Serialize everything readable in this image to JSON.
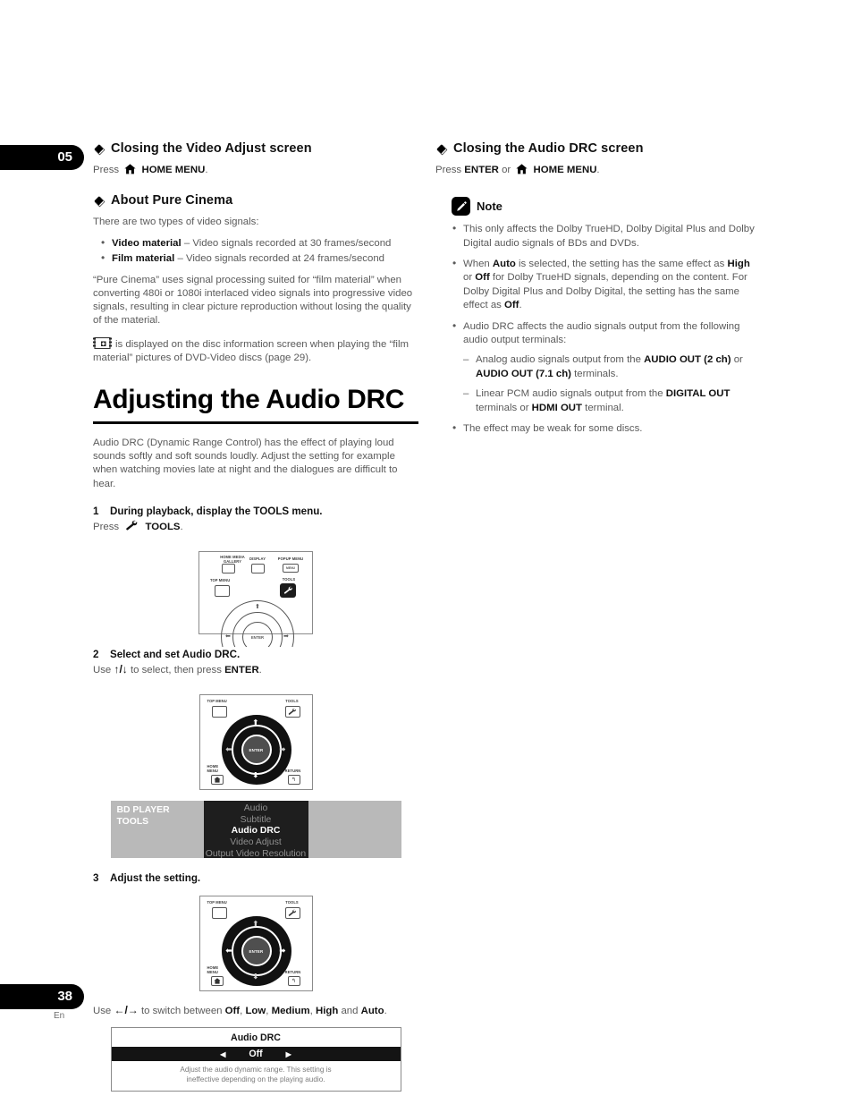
{
  "chapter_tab": "05",
  "page_tab": "38",
  "page_lang": "En",
  "left": {
    "section1": {
      "heading": "Closing the Video Adjust screen",
      "press_prefix": "Press",
      "home_menu_label": "HOME MENU",
      "period": "."
    },
    "section2": {
      "heading": "About Pure Cinema",
      "intro": "There are two types of video signals:",
      "bullets": [
        {
          "term": "Video material",
          "rest": " – Video signals recorded at 30 frames/second"
        },
        {
          "term": "Film material",
          "rest": " – Video signals recorded at 24 frames/second"
        }
      ],
      "paragraph": "“Pure Cinema” uses signal processing suited for “film material” when converting 480i or 1080i interlaced video signals into progressive video signals, resulting in clear picture reproduction without losing the quality of the material.",
      "film_note": "is displayed on the disc information screen when playing the “film material” pictures of DVD-Video discs (page 29)."
    },
    "title": "Adjusting the Audio DRC",
    "intro_paragraph": "Audio DRC (Dynamic Range Control) has the effect of playing loud sounds softly and soft sounds loudly. Adjust the setting for example when watching movies late at night and the dialogues are difficult to hear.",
    "step1": {
      "num": "1",
      "text": "During playback, display the TOOLS menu.",
      "press_prefix": "Press",
      "tools_label": "TOOLS",
      "period": "."
    },
    "step2": {
      "num": "2",
      "text": "Select and set Audio DRC.",
      "use_prefix": "Use",
      "arrows": "↑/↓",
      "use_mid": " to select, then press ",
      "enter_label": "ENTER",
      "period": "."
    },
    "step3": {
      "num": "3",
      "text": "Adjust the setting.",
      "use_prefix": "Use",
      "arrows": "←/→",
      "use_mid": " to switch between ",
      "options": [
        "Off",
        "Low",
        "Medium",
        "High",
        "Auto"
      ],
      "and_word": " and ",
      "period": "."
    },
    "osd_tools": {
      "title_line1": "BD PLAYER",
      "title_line2": "TOOLS",
      "items": [
        {
          "label": "Audio",
          "selected": false
        },
        {
          "label": "Subtitle",
          "selected": false
        },
        {
          "label": "Audio DRC",
          "selected": true
        },
        {
          "label": "Video Adjust",
          "selected": false
        },
        {
          "label": "Output Video Resolution",
          "selected": false
        }
      ]
    },
    "osd_drc": {
      "title": "Audio DRC",
      "left_arrow": "◀",
      "value": "Off",
      "right_arrow": "▶",
      "desc_line1": "Adjust the audio dynamic range. This setting is",
      "desc_line2": "ineffective depending on the playing audio."
    },
    "remote1": {
      "labels": {
        "home_media_gallery_l1": "HOME MEDIA",
        "home_media_gallery_l2": "GALLERY",
        "display": "DISPLAY",
        "popup_menu": "POPUP MENU",
        "popup_menu_word": "MENU",
        "top_menu": "TOP MENU",
        "tools": "TOOLS",
        "enter": "ENTER"
      }
    },
    "remote2": {
      "labels": {
        "top_menu": "TOP MENU",
        "tools": "TOOLS",
        "home_menu_l1": "HOME",
        "home_menu_l2": "MENU",
        "return": "RETURN",
        "enter": "ENTER"
      },
      "highlight": "vertical"
    },
    "remote3": {
      "labels": {
        "top_menu": "TOP MENU",
        "tools": "TOOLS",
        "home_menu_l1": "HOME",
        "home_menu_l2": "MENU",
        "return": "RETURN",
        "enter": "ENTER"
      },
      "highlight": "horizontal"
    }
  },
  "right": {
    "section1": {
      "heading": "Closing the Audio DRC screen",
      "press_prefix": "Press",
      "enter_label": "ENTER",
      "or_word": " or",
      "home_menu_label": "HOME MENU",
      "period": "."
    },
    "note": {
      "label": "Note",
      "items": [
        "This only affects the Dolby TrueHD, Dolby Digital Plus and Dolby Digital audio signals of BDs and DVDs.",
        "When Auto is selected, the setting has the same effect as High or Off for Dolby TrueHD signals, depending on the content. For Dolby Digital Plus and Dolby Digital, the setting has the same effect as Off.",
        "Audio DRC affects the audio signals output from the following audio output terminals:",
        "The effect may be weak for some discs."
      ],
      "sub_items": [
        "Analog audio signals output from the AUDIO OUT (2 ch) or AUDIO OUT (7.1 ch) terminals.",
        "Linear PCM audio signals output from the DIGITAL OUT terminals or HDMI OUT terminal."
      ]
    }
  },
  "colors": {
    "body_text": "#5a5a5a",
    "heading_text": "#111111",
    "tab_bg": "#000000",
    "osd_dark": "#1e1e1e",
    "osd_gray": "#b9b9b9"
  }
}
